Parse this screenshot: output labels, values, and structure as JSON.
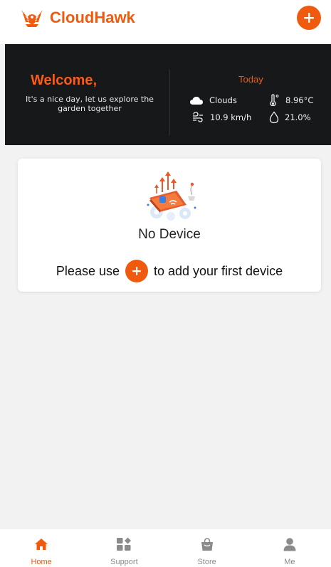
{
  "header": {
    "brand": "CloudHawk",
    "logo_icon": "hawk-logo-icon",
    "add_icon": "plus-icon"
  },
  "welcome": {
    "title": "Welcome,",
    "subtitle": "It's a nice day, let us explore the garden together"
  },
  "weather": {
    "heading": "Today",
    "condition": {
      "icon": "cloud-icon",
      "value": "Clouds"
    },
    "temperature": {
      "icon": "thermometer-icon",
      "value": "8.96°C"
    },
    "wind": {
      "icon": "wind-icon",
      "value": "10.9 km/h"
    },
    "humidity": {
      "icon": "droplet-icon",
      "value": "21.0%"
    }
  },
  "empty_state": {
    "title": "No Device",
    "hint_before": "Please use",
    "hint_after": "to add your first device"
  },
  "tabs": [
    {
      "label": "Home",
      "icon": "home-icon",
      "active": true
    },
    {
      "label": "Support",
      "icon": "grid-icon",
      "active": false
    },
    {
      "label": "Store",
      "icon": "shopping-bag-icon",
      "active": false
    },
    {
      "label": "Me",
      "icon": "user-icon",
      "active": false
    }
  ],
  "colors": {
    "accent": "#f05a0e",
    "banner_bg": "#161819",
    "page_bg": "#f2f2f2"
  }
}
